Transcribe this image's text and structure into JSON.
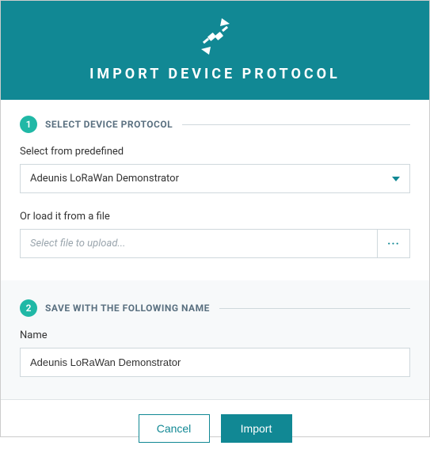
{
  "header": {
    "title": "IMPORT DEVICE PROTOCOL"
  },
  "step1": {
    "num": "1",
    "title": "SELECT DEVICE PROTOCOL",
    "predefined_label": "Select from predefined",
    "predefined_value": "Adeunis LoRaWan Demonstrator",
    "file_label": "Or load it from a file",
    "file_placeholder": "Select file to upload...",
    "file_btn": "···"
  },
  "step2": {
    "num": "2",
    "title": "SAVE WITH THE FOLLOWING NAME",
    "name_label": "Name",
    "name_value": "Adeunis LoRaWan Demonstrator"
  },
  "footer": {
    "cancel": "Cancel",
    "import": "Import"
  }
}
